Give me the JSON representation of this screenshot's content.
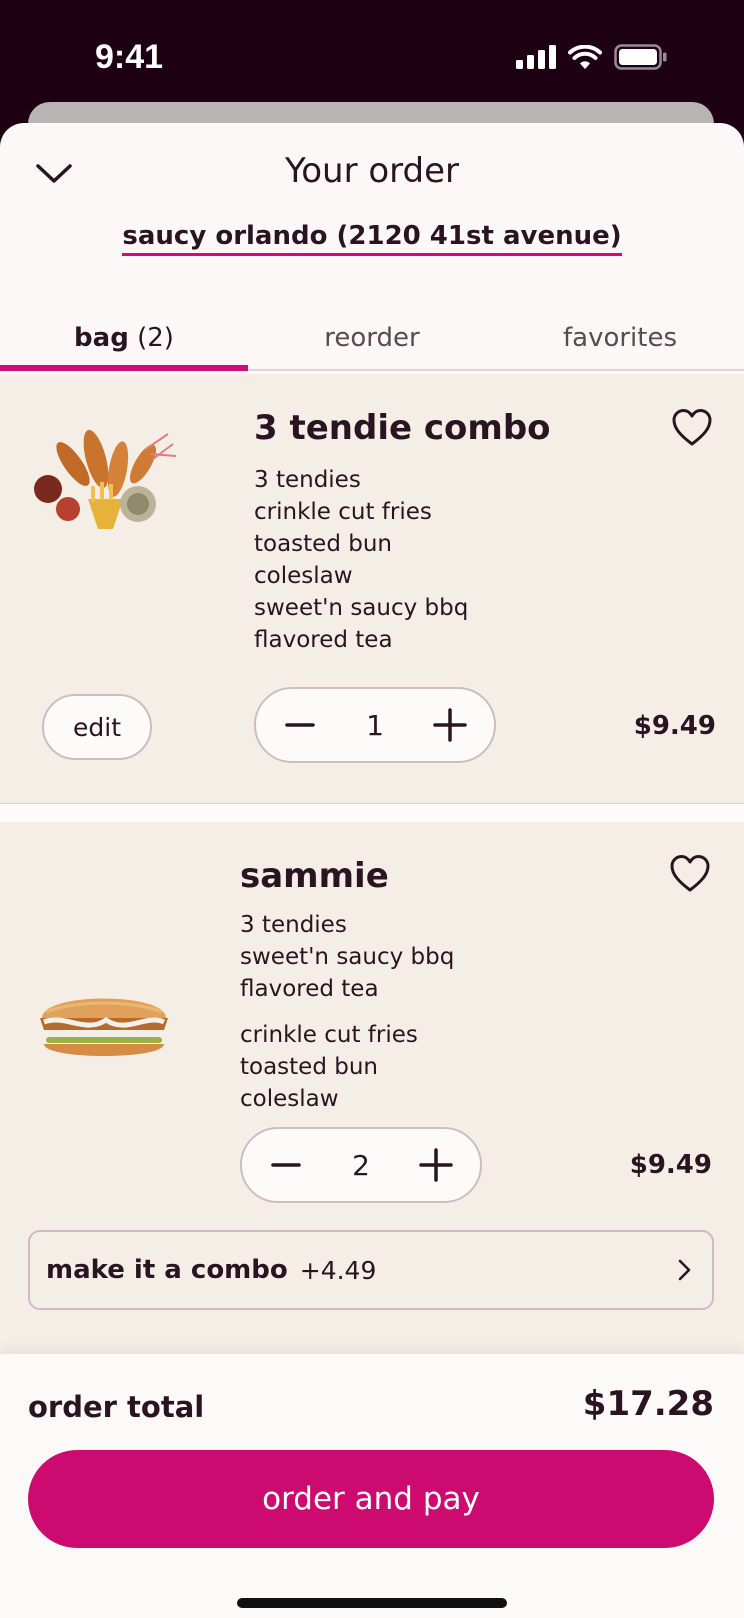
{
  "status_bar": {
    "time": "9:41"
  },
  "header": {
    "title": "Your order",
    "location": "saucy orlando (2120 41st avenue)"
  },
  "tabs": [
    {
      "label": "bag",
      "count": "(2)",
      "active": true
    },
    {
      "label": "reorder",
      "active": false
    },
    {
      "label": "favorites",
      "active": false
    }
  ],
  "items": [
    {
      "name": "3 tendie combo",
      "options": [
        "3 tendies",
        "crinkle cut fries",
        "toasted bun",
        "coleslaw",
        "sweet'n saucy bbq",
        "flavored tea"
      ],
      "edit_label": "edit",
      "quantity": "1",
      "price": "$9.49",
      "image_icon": "combo-meal-image"
    },
    {
      "name": "sammie",
      "options": [
        "3 tendies",
        "sweet'n saucy bbq",
        "flavored tea",
        "crinkle cut fries",
        "toasted bun",
        "coleslaw"
      ],
      "quantity": "2",
      "price": "$9.49",
      "image_icon": "chicken-sandwich-image",
      "combo_label": "make it a combo",
      "combo_price": "+4.49"
    }
  ],
  "footer": {
    "total_label": "order total",
    "total_value": "$17.28",
    "pay_label": "order and pay"
  },
  "colors": {
    "accent": "#cc0a6f",
    "text": "#2a1422",
    "card_bg": "#f4eee7",
    "status_bg": "#1e0013"
  }
}
